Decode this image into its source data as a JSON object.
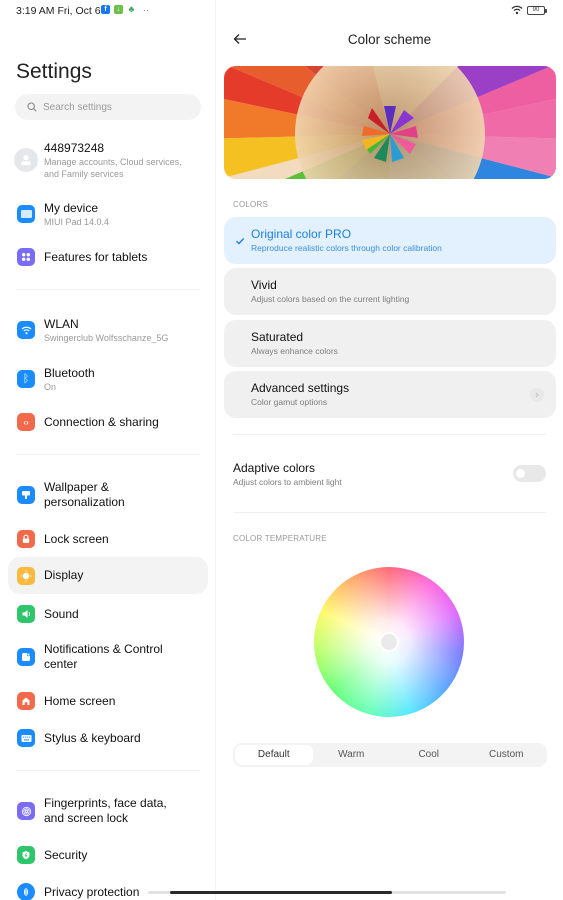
{
  "status_bar": {
    "time": "3:19 AM Fri, Oct 6",
    "notification_icons": [
      "facebook-icon",
      "download-icon",
      "play-games-icon"
    ],
    "overflow": "··",
    "battery": "90"
  },
  "sidebar": {
    "title": "Settings",
    "search": {
      "placeholder": "Search settings"
    },
    "account": {
      "label": "448973248",
      "sub": "Manage accounts, Cloud services, and Family services"
    },
    "items": [
      {
        "label": "My device",
        "sub": "MIUI Pad 14.0.4",
        "icon": "tablet-icon",
        "color": "#1a8cff"
      },
      {
        "label": "Features for tablets",
        "icon": "grid-icon",
        "color": "#7b6cf6"
      },
      {
        "label": "WLAN",
        "sub": "Swingerclub Wolfsschanze_5G",
        "icon": "wifi-icon",
        "color": "#1a8cff"
      },
      {
        "label": "Bluetooth",
        "sub": "On",
        "icon": "bluetooth-icon",
        "color": "#1a8cff"
      },
      {
        "label": "Connection & sharing",
        "icon": "share-icon",
        "color": "#f26a4b"
      },
      {
        "label": "Wallpaper & personalization",
        "icon": "wallpaper-icon",
        "color": "#1a8cff"
      },
      {
        "label": "Lock screen",
        "icon": "lock-icon",
        "color": "#f26a4b"
      },
      {
        "label": "Display",
        "icon": "sun-icon",
        "color": "#f7b93e",
        "active": true
      },
      {
        "label": "Sound",
        "icon": "speaker-icon",
        "color": "#2ec56b"
      },
      {
        "label": "Notifications & Control center",
        "icon": "notification-icon",
        "color": "#1a8cff"
      },
      {
        "label": "Home screen",
        "icon": "home-icon",
        "color": "#f26a4b"
      },
      {
        "label": "Stylus & keyboard",
        "icon": "keyboard-icon",
        "color": "#1a8cff"
      },
      {
        "label": "Fingerprints, face data, and screen lock",
        "icon": "fingerprint-icon",
        "color": "#7b6cf6"
      },
      {
        "label": "Security",
        "icon": "shield-icon",
        "color": "#2ec56b"
      },
      {
        "label": "Privacy protection",
        "icon": "privacy-icon",
        "color": "#1a8cff"
      }
    ]
  },
  "detail": {
    "title": "Color scheme",
    "colors_section": "COLORS",
    "options": [
      {
        "title": "Original color PRO",
        "sub": "Reproduce realistic colors through color calibration",
        "selected": true
      },
      {
        "title": "Vivid",
        "sub": "Adjust colors based on the current lighting"
      },
      {
        "title": "Saturated",
        "sub": "Always enhance colors"
      },
      {
        "title": "Advanced settings",
        "sub": "Color gamut options",
        "has_chevron": true
      }
    ],
    "adaptive": {
      "title": "Adaptive colors",
      "sub": "Adjust colors to ambient light",
      "enabled": false
    },
    "temperature_section": "COLOR TEMPERATURE",
    "temperature_modes": [
      "Default",
      "Warm",
      "Cool",
      "Custom"
    ],
    "temperature_selected": "Default",
    "accent_color": "#1e80e0"
  }
}
